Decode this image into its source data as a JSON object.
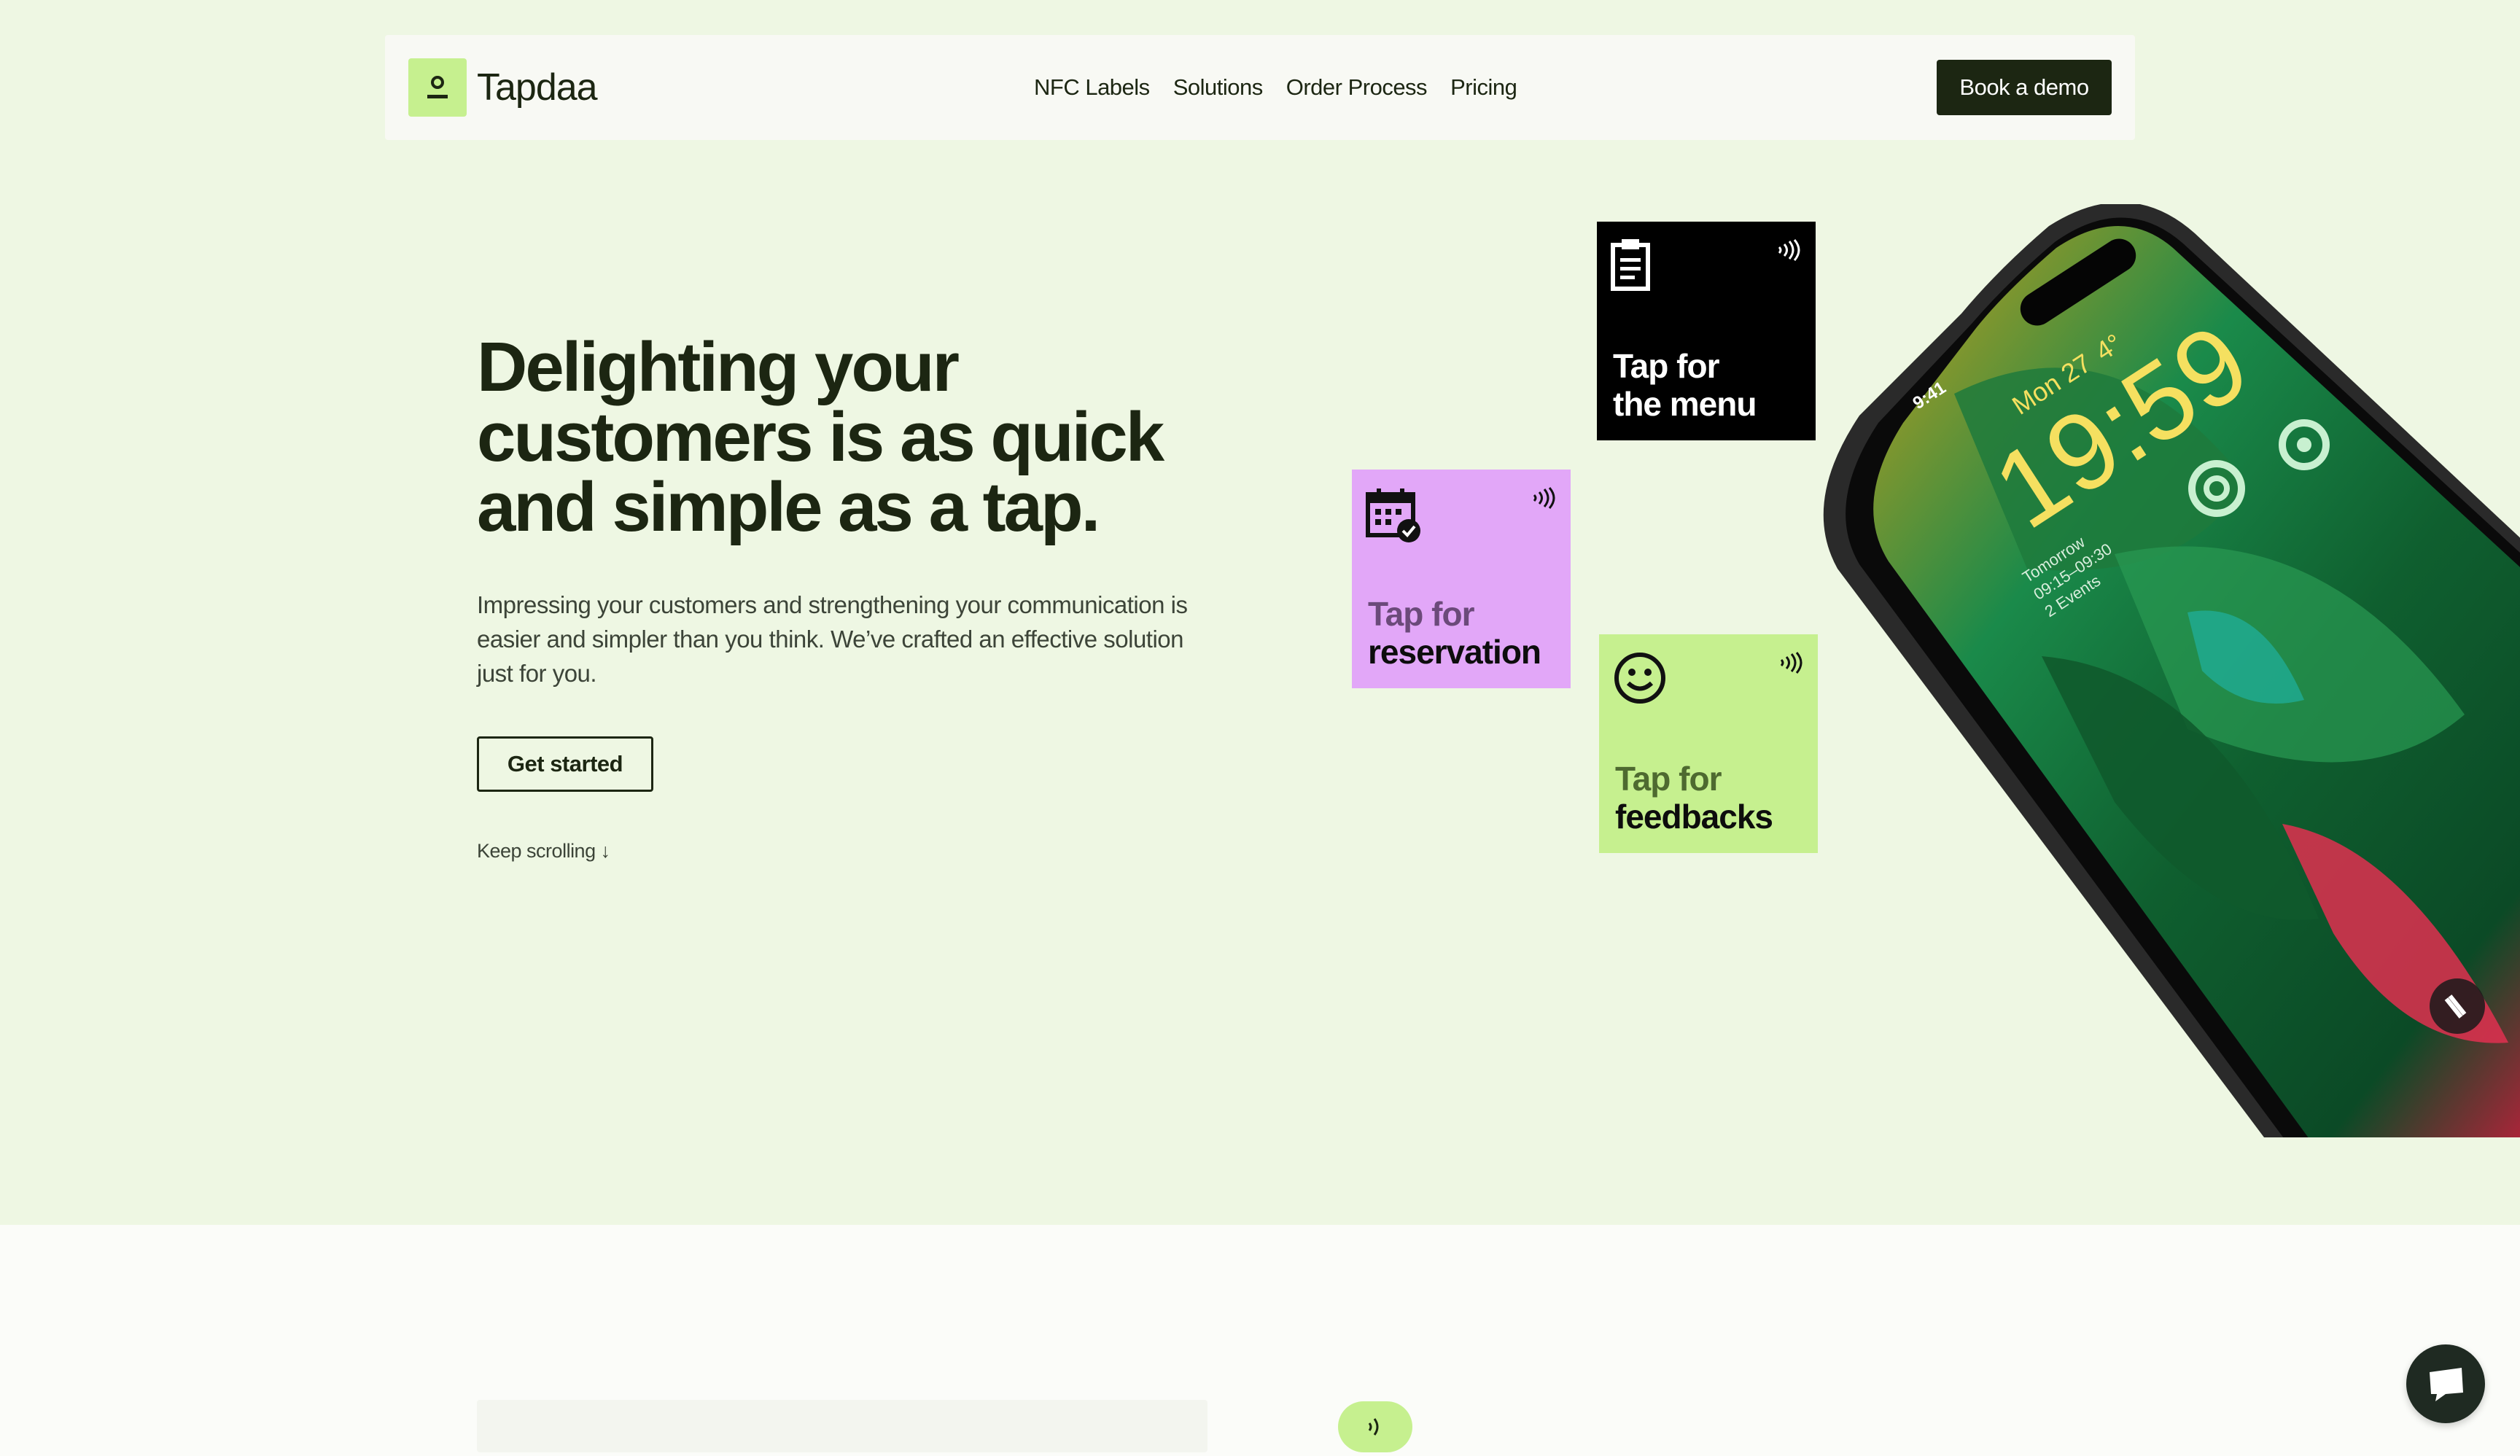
{
  "nav": {
    "logo_text": "Tapdaa",
    "links": [
      "NFC Labels",
      "Solutions",
      "Order Process",
      "Pricing"
    ],
    "cta_label": "Book a demo"
  },
  "hero": {
    "headline_lines": [
      "Delighting your",
      "customers is as quick",
      "and simple as a tap."
    ],
    "subtext": "Impressing your customers and strengthening your communication is easier and simpler than you think. We’ve crafted an effective solution just for you.",
    "cta_label": "Get started",
    "scroll_hint": "Keep scrolling ↓"
  },
  "cards": {
    "menu": {
      "line1": "Tap for",
      "line2": "the menu",
      "color": "#000000"
    },
    "reservation": {
      "line1": "Tap for",
      "line2": "reservation",
      "color": "#e2a7f8"
    },
    "feedback": {
      "line1": "Tap for",
      "line2": "feedbacks",
      "color": "#c6f08f"
    }
  },
  "phone": {
    "status_time": "9:41",
    "date": "Mon 27",
    "weather": "4°",
    "clock": "19:59",
    "event_day": "Tomorrow",
    "event_time": "09:15–09:30",
    "event_count": "2 Events"
  },
  "colors": {
    "accent_green": "#c6f08f",
    "dark": "#1c2612",
    "hero_bg": "#eef7e3",
    "lavender": "#e2a7f8"
  }
}
